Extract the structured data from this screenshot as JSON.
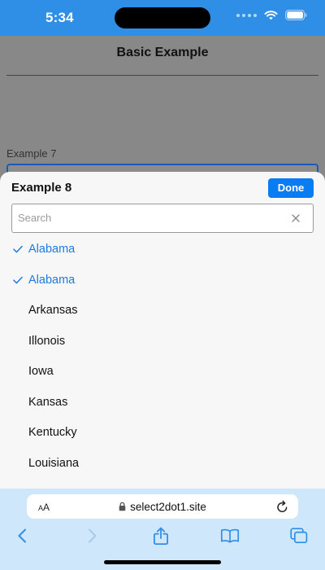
{
  "status_bar": {
    "time": "5:34",
    "icons": [
      "signal-dots-icon",
      "wifi-icon",
      "battery-icon"
    ]
  },
  "page": {
    "title": "Basic Example",
    "example_7_label": "Example 7"
  },
  "sheet": {
    "title": "Example 8",
    "done_label": "Done",
    "search_placeholder": "Search",
    "search_value": "",
    "options": [
      {
        "label": "Alabama",
        "selected": true
      },
      {
        "label": "Alabama",
        "selected": true
      },
      {
        "label": "Arkansas",
        "selected": false
      },
      {
        "label": "Illonois",
        "selected": false
      },
      {
        "label": "Iowa",
        "selected": false
      },
      {
        "label": "Kansas",
        "selected": false
      },
      {
        "label": "Kentucky",
        "selected": false
      },
      {
        "label": "Louisiana",
        "selected": false
      }
    ]
  },
  "browser": {
    "text_size_small": "A",
    "text_size_big": "A",
    "url": "select2dot1.site",
    "toolbar_icons": [
      "back-icon",
      "forward-icon",
      "share-icon",
      "bookmarks-icon",
      "tabs-icon"
    ]
  },
  "colors": {
    "status_bar": "#2f8fe6",
    "accent": "#0a7cf2",
    "selected_text": "#1f7ae0",
    "toolbar_bg": "#cfe7fb",
    "toolbar_icon": "#2f8fe6"
  }
}
